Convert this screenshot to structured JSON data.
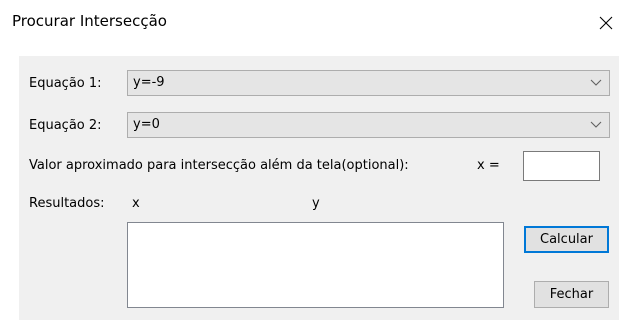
{
  "window": {
    "title": "Procurar Intersecção",
    "close_icon": "close-icon"
  },
  "form": {
    "equation1": {
      "label": "Equação 1:",
      "selected_value": "y=-9"
    },
    "equation2": {
      "label": "Equação 2:",
      "selected_value": "y=0"
    },
    "approx": {
      "label": "Valor aproximado para intersecção além da tela(optional):",
      "x_label": "x  =",
      "value": ""
    },
    "results": {
      "label": "Resultados:",
      "x_header": "x",
      "y_header": "y"
    }
  },
  "buttons": {
    "calculate": "Calcular",
    "close": "Fechar"
  }
}
